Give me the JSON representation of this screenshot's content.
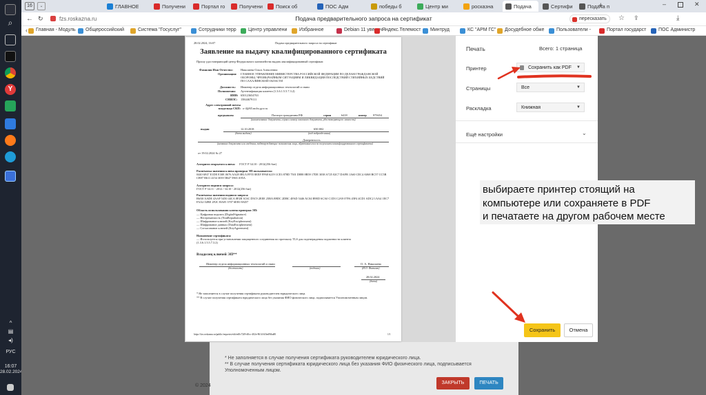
{
  "browser": {
    "tab_count": "16",
    "tabs": [
      {
        "label": "ГЛАВНОЕ",
        "fav": "#1a7fd4"
      },
      {
        "label": "Получени",
        "fav": "#d92b2b"
      },
      {
        "label": "Портал го",
        "fav": "#d92b2b"
      },
      {
        "label": "Получени",
        "fav": "#d92b2b"
      },
      {
        "label": "Поиск об",
        "fav": "#d92b2b"
      },
      {
        "label": "ПОС Адм",
        "fav": "#2563b8"
      },
      {
        "label": "победы б",
        "fav": "#c99a06"
      },
      {
        "label": "Центр ми",
        "fav": "#3cab5a"
      },
      {
        "label": "росказна",
        "fav": "#f2a30f"
      },
      {
        "label": "Подача",
        "fav": "#555555"
      },
      {
        "label": "Сертифи",
        "fav": "#555555"
      },
      {
        "label": "Подача п",
        "fav": "#555555"
      }
    ],
    "url": "fzs.roskazna.ru",
    "page_title": "Подача предварительного запроса на сертификат",
    "translate_label": "пересказать",
    "bookmarks": [
      {
        "label": "Главная - Модуль",
        "fav": "#e0a52a"
      },
      {
        "label": "Общероссийский",
        "fav": "#3a8fd6"
      },
      {
        "label": "Система \"Госуслуг\"",
        "fav": "#e0a52a"
      },
      {
        "label": "Сотрудники терр",
        "fav": "#3a8fd6"
      },
      {
        "label": "Центр управлени",
        "fav": "#3cab5a"
      },
      {
        "label": "Избранное",
        "fav": "#e0a52a"
      },
      {
        "label": "Debian 11 увелич",
        "fav": "#c4314b"
      },
      {
        "label": "Яндекс.Телемост",
        "fav": "#d92b2b"
      },
      {
        "label": "Минтруд",
        "fav": "#3a8fd6"
      },
      {
        "label": "КС \"АРМ ГС\"",
        "fav": "#3a8fd6"
      },
      {
        "label": "Досудебное обже",
        "fav": "#e0a52a"
      },
      {
        "label": "Пользователи -",
        "fav": "#3a8fd6"
      },
      {
        "label": "Портал государст",
        "fav": "#d92b2b"
      },
      {
        "label": "ПОС Администр",
        "fav": "#2563b8"
      }
    ]
  },
  "taskbar": {
    "lang": "РУС",
    "time": "16:07",
    "date": "28.02.2024"
  },
  "print_dialog": {
    "title": "Печать",
    "total": "Всего: 1 страница",
    "printer_label": "Принтер",
    "printer_value": "Сохранить как PDF",
    "pages_label": "Страницы",
    "pages_value": "Все",
    "layout_label": "Раскладка",
    "layout_value": "Книжная",
    "more_label": "Ещё настройки",
    "save_button": "Сохранить",
    "cancel_button": "Отмена"
  },
  "document": {
    "header_left": "28.02.2024, 16:07",
    "header_center": "Подача предварительного запроса на сертификат",
    "title": "Заявление на выдачу квалифицированного сертификата",
    "intro": "Прошу удостоверяющий центр Федерального казначейства выдать квалифицированный сертификат.",
    "fio_label": "Фамилия Имя Отчество:",
    "fio_value": "Николаева Ольга Алексеевна",
    "org_label": "Организация:",
    "org_value": "ГЛАВНОЕ УПРАВЛЕНИЕ МИНИСТЕРСТВА РОССИЙСКОЙ ФЕДЕРАЦИИ ПО ДЕЛАМ ГРАЖДАНСКОЙ ОБОРОНЫ, ЧРЕЗВЫЧАЙНЫМ СИТУАЦИЯМ И ЛИКВИДАЦИИ ПОСЛЕДСТВИЙ СТИХИЙНЫХ БЕДСТВИЙ ПО САХАЛИНСКОЙ ОБЛАСТИ",
    "pos_label": "Должность:",
    "pos_value": "Инженер отдела информационных технологий и связи",
    "auth_label": "Полномочия:",
    "auth_value": "Аутентификация клиента (1.3.6.1.5.5.7.3.2)",
    "inn_label": "ИНН:",
    "inn_value": "650123654763",
    "snils_label": "СНИЛС:",
    "snils_value": "15844679111",
    "email_label": "Адрес электронной почты владельца СКП:",
    "email_value": "o-4@65.mchs.gov.ru",
    "id_label": "предъявлен",
    "id_doc": "Паспорт гражданина РФ",
    "series_label": "серия",
    "series_value": "6418",
    "number_label": "номер",
    "number_value": "975654",
    "id_caption": "(наименование документа, серия и номер основного документа, удостоверяющего личность)",
    "issued_label": "выдан",
    "issued_date": "12.10.2018",
    "issued_code": "650-002",
    "date_caption": "(дата выдачи)",
    "code_caption": "(код подразделения)",
    "power_label": "Доверенность",
    "power_caption": "(название документа или сведения, подтверждающие полномочия лица, обратившегося за получением квалифицированного сертификата)",
    "power_ref": "от 19.02.2024 № 27",
    "algo_label": "Алгоритм открытого ключа:",
    "algo_value": "ГОСТ Р 34.10 - 2012(256 бит)",
    "pubkey_label": "Распечатка значения ключа проверки ЭП пользователя:",
    "pubkey_value": "0440 6F47 E1DE E30E 0676 AA28 0B1A FF55 8EEF FF68 6219 1CE3 878D 7501 D888 8B59 17DE 3038 A725 02C7 DAFB 1A60 CEC4 A068 BC57 CC5B CB97 B611 4154 3039 5B47 5965 A95A",
    "sigalg_label": "Алгоритм подписи запроса:",
    "sigalg_value": "ГОСТ Р 34.11 - 2012 / 34.10 - 2012(256 бит)",
    "sig_label": "Распечатка значения подписи запроса:",
    "sig_value": "B6A8 AADE 4AAF 5450 44CA 8F2B 3C6C D5C9 2EEE 25BA B9DC 2DBC 4FAD 5446 AC04 B9ED 6CA0 C1D3 C2A9 07FA 45F4 4CD1 ADC2 1AA4 1EC7 FAA2 02BE 2F2C BA05 3707 6EE0 8AD7",
    "usage_label": "Область использования ключа проверки ЭП:",
    "usage_lines": [
      "— Цифровая подпись (DigitalSignature)",
      "— Неотрекаемость (NonRepudiation)",
      "— Шифрование ключей (KeyEncipherment)",
      "— Шифрование данных (DataEncipherment)",
      "— Согласование ключей (KeyAgreement)"
    ],
    "purpose_label": "Назначение сертификата:",
    "purpose_value": "— Используется при установлении защищенного соединения по протоколу TLS для подтверждения подлинности клиента (1.3.6.1.5.5.7.3.2)",
    "owner_heading": "Владелец ключей ЭП**",
    "owner_position": "Инженер отдела информационных технологий и связи",
    "owner_name": "О. А. Николаева",
    "owner_date": "28.02.2024",
    "cap_position": "(должность)",
    "cap_sign": "(подпись)",
    "cap_fio": "(И.О. Фамилия)",
    "cap_date": "(дата)",
    "foot1": "* Не заполняется в случае получения сертификата руководителем юридического лица.",
    "foot2": "** В случае получения сертификата юридического лица без указания ФИО физического лица, подписывается Уполномоченным лицом.",
    "footer_url": "https://fzs.roskazna.ru/public/requests/edit/ed0c72f8-d0cc-402e-8614-b5fed9fba80",
    "footer_page": "1/1"
  },
  "background_form": {
    "foot1": "* Не заполняется в случае получения сертификата руководителем юридического лица.",
    "foot2": "** В случае получения сертификата юридического лица без указания ФИО физического лица, подписывается Уполномоченным лицом.",
    "close_button": "ЗАКРЫТЬ",
    "print_button": "ПЕЧАТЬ",
    "copyright": "© 2024"
  },
  "annotation": {
    "text_line1": "выбираете принтер стоящий на",
    "text_line2": "компьютере или сохраняете в PDF",
    "text_line3": "и печатаете на другом рабочем месте",
    "arrow_color": "#e0321f"
  }
}
